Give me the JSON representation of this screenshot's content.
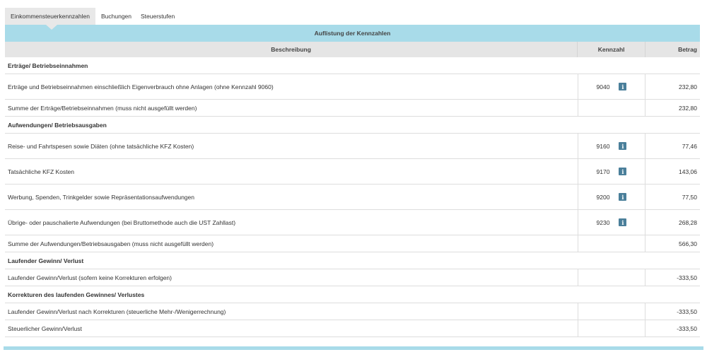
{
  "tabs": [
    {
      "label": "Einkommensteuerkennzahlen",
      "active": true
    },
    {
      "label": "Buchungen",
      "active": false
    },
    {
      "label": "Steuerstufen",
      "active": false
    }
  ],
  "banner": {
    "title": "Auflistung der Kennzahlen"
  },
  "columns": {
    "description": "Beschreibung",
    "code": "Kennzahl",
    "amount": "Betrag"
  },
  "rows": [
    {
      "type": "section",
      "label": "Erträge/ Betriebseinnahmen"
    },
    {
      "type": "data",
      "label": "Erträge und Betriebseinnahmen einschließlich Eigenverbrauch ohne Anlagen (ohne Kennzahl 9060)",
      "code": "9040",
      "info": true,
      "amount": "232,80",
      "size": "tall"
    },
    {
      "type": "data",
      "label": "Summe der Erträge/Betriebseinnahmen (muss nicht ausgefüllt werden)",
      "code": "",
      "info": false,
      "amount": "232,80",
      "size": "short"
    },
    {
      "type": "section",
      "label": "Aufwendungen/ Betriebsausgaben"
    },
    {
      "type": "data",
      "label": "Reise- und Fahrtspesen sowie Diäten (ohne tatsächliche KFZ Kosten)",
      "code": "9160",
      "info": true,
      "amount": "77,46",
      "size": "tall"
    },
    {
      "type": "data",
      "label": "Tatsächliche KFZ Kosten",
      "code": "9170",
      "info": true,
      "amount": "143,06",
      "size": "tall"
    },
    {
      "type": "data",
      "label": "Werbung, Spenden, Trinkgelder sowie Repräsentationsaufwendungen",
      "code": "9200",
      "info": true,
      "amount": "77,50",
      "size": "tall"
    },
    {
      "type": "data",
      "label": "Übrige- oder pauschalierte Aufwendungen (bei Bruttomethode auch die UST Zahllast)",
      "code": "9230",
      "info": true,
      "amount": "268,28",
      "size": "tall"
    },
    {
      "type": "data",
      "label": "Summe der Aufwendungen/Betriebsausgaben (muss nicht ausgefüllt werden)",
      "code": "",
      "info": false,
      "amount": "566,30",
      "size": "short"
    },
    {
      "type": "section",
      "label": "Laufender Gewinn/ Verlust"
    },
    {
      "type": "data",
      "label": "Laufender Gewinn/Verlust (sofern keine Korrekturen erfolgen)",
      "code": "",
      "info": false,
      "amount": "-333,50",
      "size": "short"
    },
    {
      "type": "section",
      "label": "Korrekturen des laufenden Gewinnes/ Verlustes"
    },
    {
      "type": "data",
      "label": "Laufender Gewinn/Verlust nach Korrekturen (steuerliche Mehr-/Wenigerrechnung)",
      "code": "",
      "info": false,
      "amount": "-333,50",
      "size": "short"
    },
    {
      "type": "data",
      "label": "Steuerlicher Gewinn/Verlust",
      "code": "",
      "info": false,
      "amount": "-333,50",
      "size": "short"
    }
  ],
  "icons": {
    "info": "info-icon",
    "info_glyph": "i"
  },
  "colors": {
    "banner": "#a8dbe9",
    "header": "#e5e5e5",
    "info_icon": "#4a7f9a"
  }
}
